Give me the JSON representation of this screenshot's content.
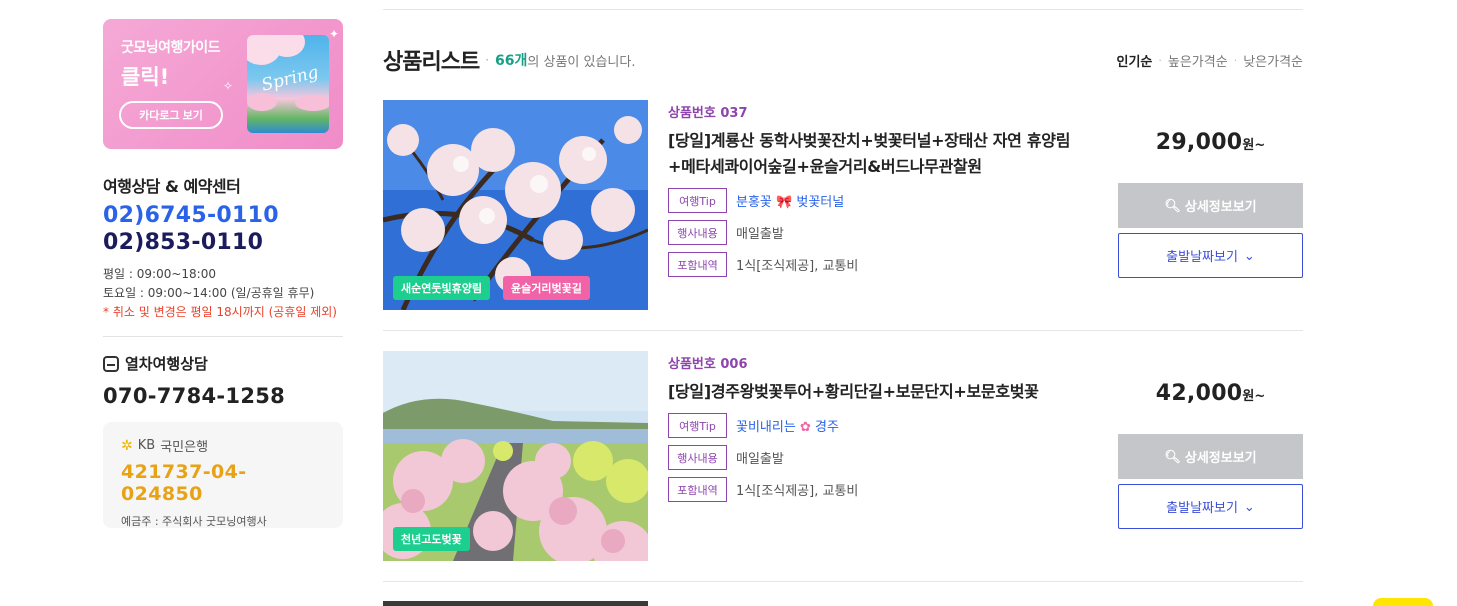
{
  "banner": {
    "subtitle": "굿모닝여행가이드",
    "title": "클릭!",
    "button_label": "카다로그 보기",
    "art_text": "Spring"
  },
  "contact": {
    "title": "여행상담 & 예약센터",
    "phone_primary": "02)6745-0110",
    "phone_secondary": "02)853-0110",
    "weekday_hours": "평일 : 09:00~18:00",
    "saturday_hours": "토요일 : 09:00~14:00 (일/공휴일 휴무)",
    "notice": "* 취소 및 변경은 평일 18시까지 (공휴일 제외)"
  },
  "train": {
    "title": "열차여행상담",
    "phone": "070-7784-1258"
  },
  "bank": {
    "logo": "KB",
    "name": "국민은행",
    "account": "421737-04-024850",
    "holder": "예금주 : 주식회사 굿모닝여행사"
  },
  "list": {
    "title": "상품리스트",
    "count": "66개",
    "count_suffix": "의 상품이 있습니다.",
    "sorts": [
      "인기순",
      "높은가격순",
      "낮은가격순"
    ]
  },
  "labels": {
    "tip": "여행Tip",
    "schedule": "행사내용",
    "included": "포함내역",
    "detail_button": "상세정보보기",
    "date_button": "출발날짜보기",
    "price_unit": "원~"
  },
  "products": [
    {
      "number": "상품번호 037",
      "name_line1": "[당일]계룡산 동학사벚꽃잔치+벚꽃터널+장태산 자연 휴양림",
      "name_line2": "+메타세콰이어숲길+윤슬거리&버드나무관찰원",
      "tip_before": "분홍꽃",
      "tip_after": "벚꽃터널",
      "schedule": "매일출발",
      "included": "1식[조식제공], 교통비",
      "price": "29,000",
      "badges": [
        "새순연둣빛휴양림",
        "윤슬거리벚꽃길"
      ]
    },
    {
      "number": "상품번호 006",
      "name_line1": "[당일]경주왕벚꽃투어+황리단길+보문단지+보문호벚꽃",
      "name_line2": "",
      "tip_before": "꽃비내리는",
      "tip_after": "경주",
      "schedule": "매일출발",
      "included": "1식[조식제공], 교통비",
      "price": "42,000",
      "badges": [
        "천년고도벚꽃"
      ]
    }
  ],
  "colors": {
    "accent_blue": "#2a63e8",
    "navy": "#1c1c5c",
    "purple": "#8e44ad",
    "teal": "#16a085",
    "bank_gold": "#e8a216",
    "badge_green": "#1ccf8e",
    "badge_pink": "#f162a6"
  }
}
